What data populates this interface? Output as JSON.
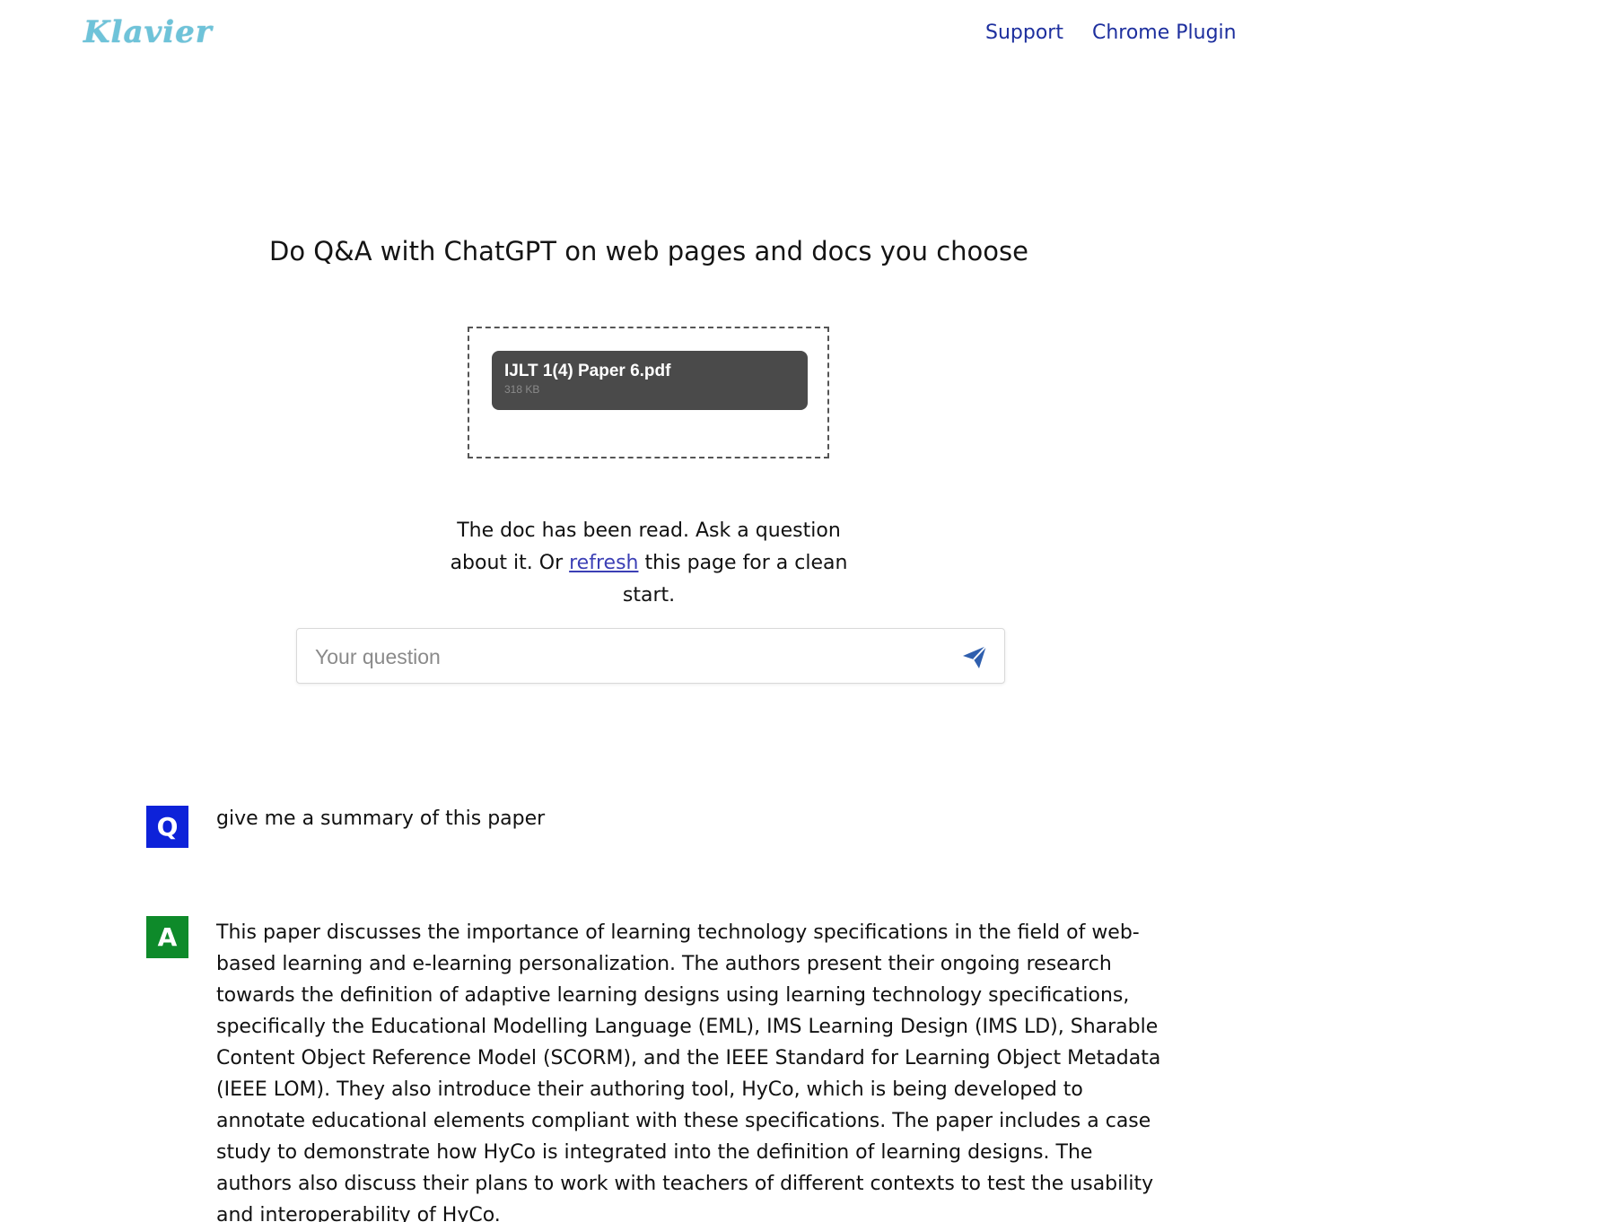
{
  "header": {
    "logo_text": "Klavier",
    "nav": [
      {
        "label": "Support"
      },
      {
        "label": "Chrome Plugin"
      }
    ]
  },
  "headline": "Do Q&A with ChatGPT on web pages and docs you choose",
  "upload": {
    "file_name": "IJLT 1(4) Paper 6.pdf",
    "file_size": "318 KB"
  },
  "status": {
    "before_link": "The doc has been read. Ask a question about it. Or ",
    "link": "refresh",
    "after_link": " this page for a clean start."
  },
  "question_input": {
    "placeholder": "Your question",
    "value": "",
    "send_icon": "send-icon",
    "send_icon_color": "#2f5fae"
  },
  "conversation": {
    "q_label": "Q",
    "q_color": "#0d22d9",
    "question": "give me a summary of this paper",
    "a_label": "A",
    "a_color": "#0e8a2a",
    "answer": "This paper discusses the importance of learning technology specifications in the field of web-based learning and e-learning personalization. The authors present their ongoing research towards the definition of adaptive learning designs using learning technology specifications, specifically the Educational Modelling Language (EML), IMS Learning Design (IMS LD), Sharable Content Object Reference Model (SCORM), and the IEEE Standard for Learning Object Metadata (IEEE LOM). They also introduce their authoring tool, HyCo, which is being developed to annotate educational elements compliant with these specifications. The paper includes a case study to demonstrate how HyCo is integrated into the definition of learning designs. The authors also discuss their plans to work with teachers of different contexts to test the usability and interoperability of HyCo."
  }
}
